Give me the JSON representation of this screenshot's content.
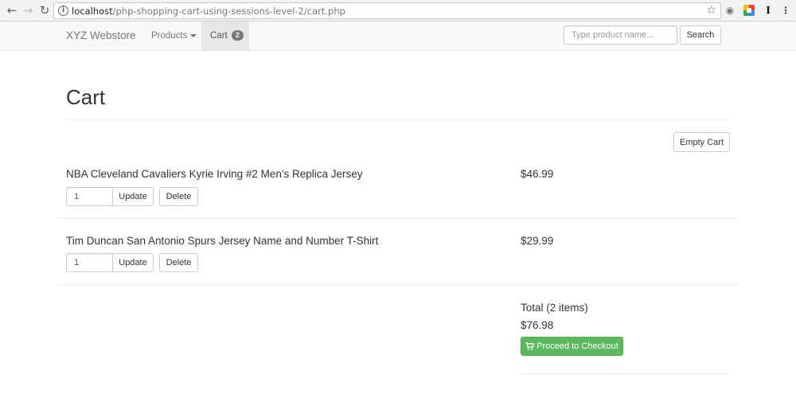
{
  "browser": {
    "url_host": "localhost",
    "url_path": "/php-shopping-cart-using-sessions-level-2/cart.php",
    "icons": [
      "back-icon",
      "forward-icon",
      "info-icon",
      "star-icon",
      "camera-icon",
      "color-extension-icon",
      "text-extension-icon",
      "menu-icon"
    ]
  },
  "navbar": {
    "brand": "XYZ Webstore",
    "products_label": "Products",
    "cart_label": "Cart",
    "cart_count": "2",
    "search_placeholder": "Type product name...",
    "search_button": "Search"
  },
  "page": {
    "title": "Cart",
    "empty_cart_label": "Empty Cart"
  },
  "items": [
    {
      "name": "NBA Cleveland Cavaliers Kyrie Irving #2 Men's Replica Jersey",
      "price": "$46.99",
      "quantity": "1",
      "update_label": "Update",
      "delete_label": "Delete"
    },
    {
      "name": "Tim Duncan San Antonio Spurs Jersey Name and Number T-Shirt",
      "price": "$29.99",
      "quantity": "1",
      "update_label": "Update",
      "delete_label": "Delete"
    }
  ],
  "summary": {
    "total_label": "Total (2 items)",
    "total_amount": "$76.98",
    "checkout_label": "Proceed to Checkout"
  },
  "colors": {
    "checkout_green": "#5cb85c",
    "navbar_bg": "#f8f8f8",
    "active_tab_bg": "#e7e7e7",
    "badge_gray": "#777777"
  }
}
